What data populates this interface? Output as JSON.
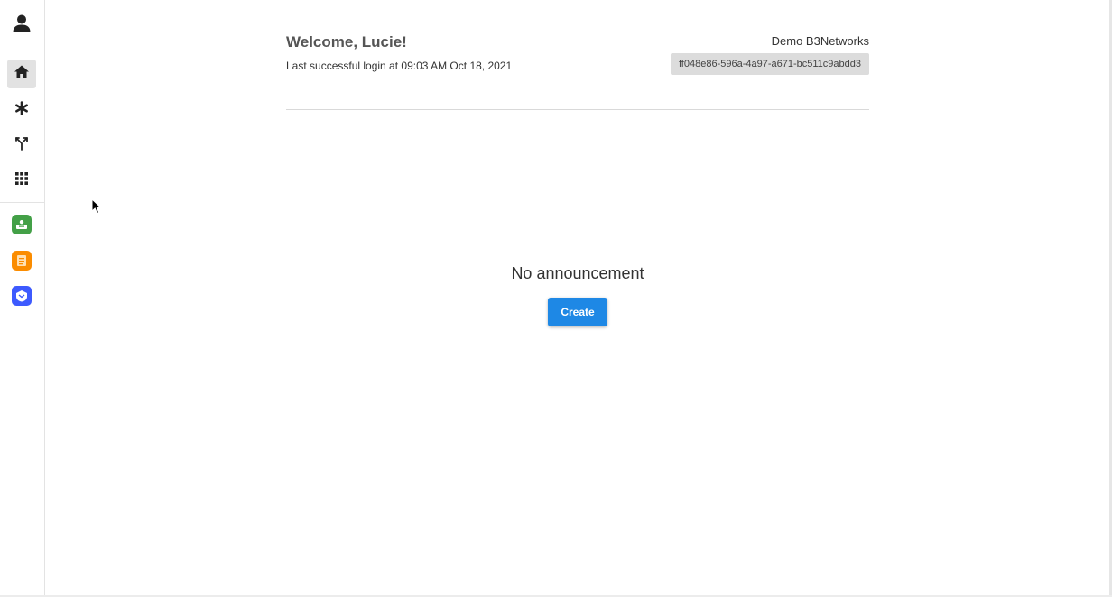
{
  "header": {
    "welcome": "Welcome, Lucie!",
    "last_login": "Last successful login at 09:03 AM Oct 18, 2021",
    "org_name": "Demo B3Networks",
    "org_id": "ff048e86-596a-4a97-a671-bc511c9abdd3"
  },
  "main": {
    "empty_text": "No announcement",
    "create_label": "Create"
  },
  "colors": {
    "primary": "#1e88e5",
    "app_green": "#43a047",
    "app_orange": "#fb8c00",
    "app_indigo": "#3d5afe"
  },
  "sidebar": {
    "icons": [
      "user-icon",
      "home-icon",
      "asterisk-icon",
      "flow-icon",
      "apps-grid-icon",
      "green-app-icon",
      "orange-app-icon",
      "blue-app-icon"
    ]
  }
}
